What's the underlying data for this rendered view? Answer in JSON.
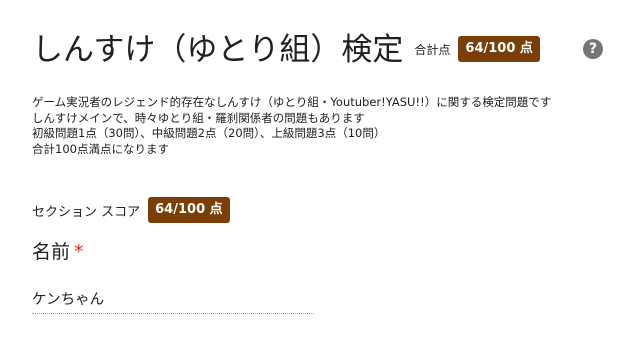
{
  "form": {
    "title": "しんすけ（ゆとり組）検定",
    "total_label": "合計点",
    "total_score": "64/100 点",
    "help_icon": "help-circle-icon",
    "description_lines": [
      "ゲーム実況者のレジェンド的存在なしんすけ（ゆとり組・Youtuber!YASU!!）に関する検定問題です",
      "しんすけメインで、時々ゆとり組・羅刹関係者の問題もあります",
      "初級問題1点（30問）、中級問題2点（20問）、上級問題3点（10問）",
      "合計100点満点になります"
    ]
  },
  "section": {
    "score_label": "セクション スコア",
    "score": "64/100 点"
  },
  "question": {
    "title": "名前",
    "required_mark": "*",
    "answer": "ケンちゃん"
  },
  "colors": {
    "badge_bg": "#7a3e07",
    "required": "#d93025",
    "help_icon": "#757575"
  }
}
